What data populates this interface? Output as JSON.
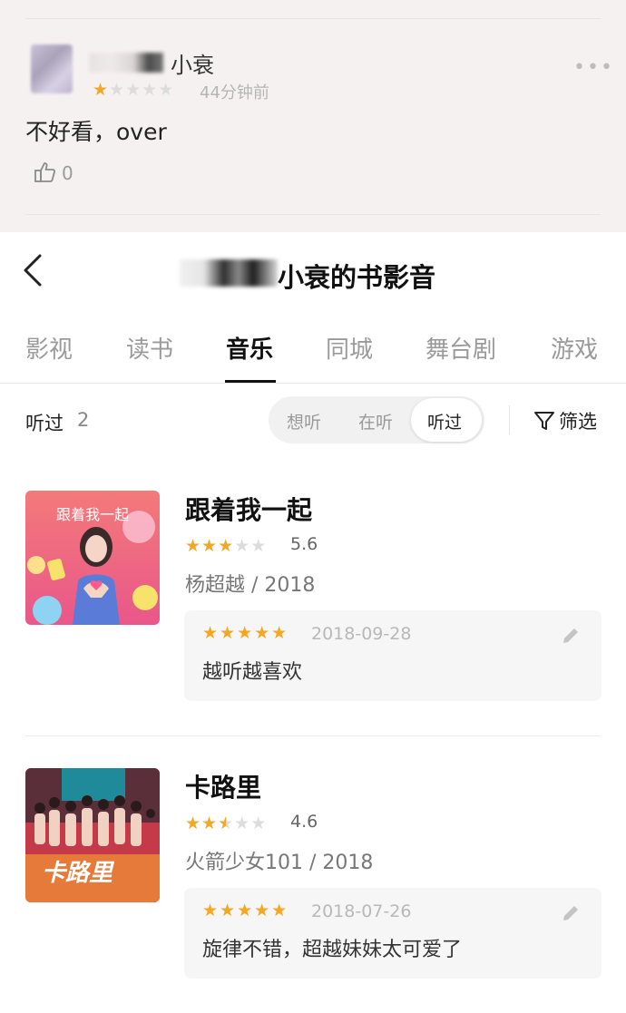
{
  "comment": {
    "username": "小衰",
    "rating": 1,
    "time": "44分钟前",
    "text": "不好看，over",
    "likes": "0",
    "more_icon": "more-horizontal-icon"
  },
  "nav": {
    "title": "小衰的书影音"
  },
  "tabs": [
    "影视",
    "读书",
    "音乐",
    "同城",
    "舞台剧",
    "游戏"
  ],
  "active_tab": "音乐",
  "filter": {
    "label": "听过",
    "count": "2",
    "segments": [
      "想听",
      "在听",
      "听过"
    ],
    "active_segment": "听过",
    "filter_label": "筛选"
  },
  "items": [
    {
      "title": "跟着我一起",
      "rating": 3,
      "score": "5.6",
      "meta": "杨超越 / 2018",
      "cover_text": "跟着我一起",
      "review": {
        "rating": 5,
        "date": "2018-09-28",
        "text": "越听越喜欢"
      }
    },
    {
      "title": "卡路里",
      "rating": 2.5,
      "score": "4.6",
      "meta": "火箭少女101 / 2018",
      "cover_text": "卡路里",
      "review": {
        "rating": 5,
        "date": "2018-07-26",
        "text": "旋律不错，超越妹妹太可爱了"
      }
    }
  ],
  "colors": {
    "star": "#f5a623",
    "star_off": "#dcdcdc",
    "comment_bg": "#f6f1f1",
    "text_primary": "#111111",
    "text_secondary": "#999999"
  }
}
